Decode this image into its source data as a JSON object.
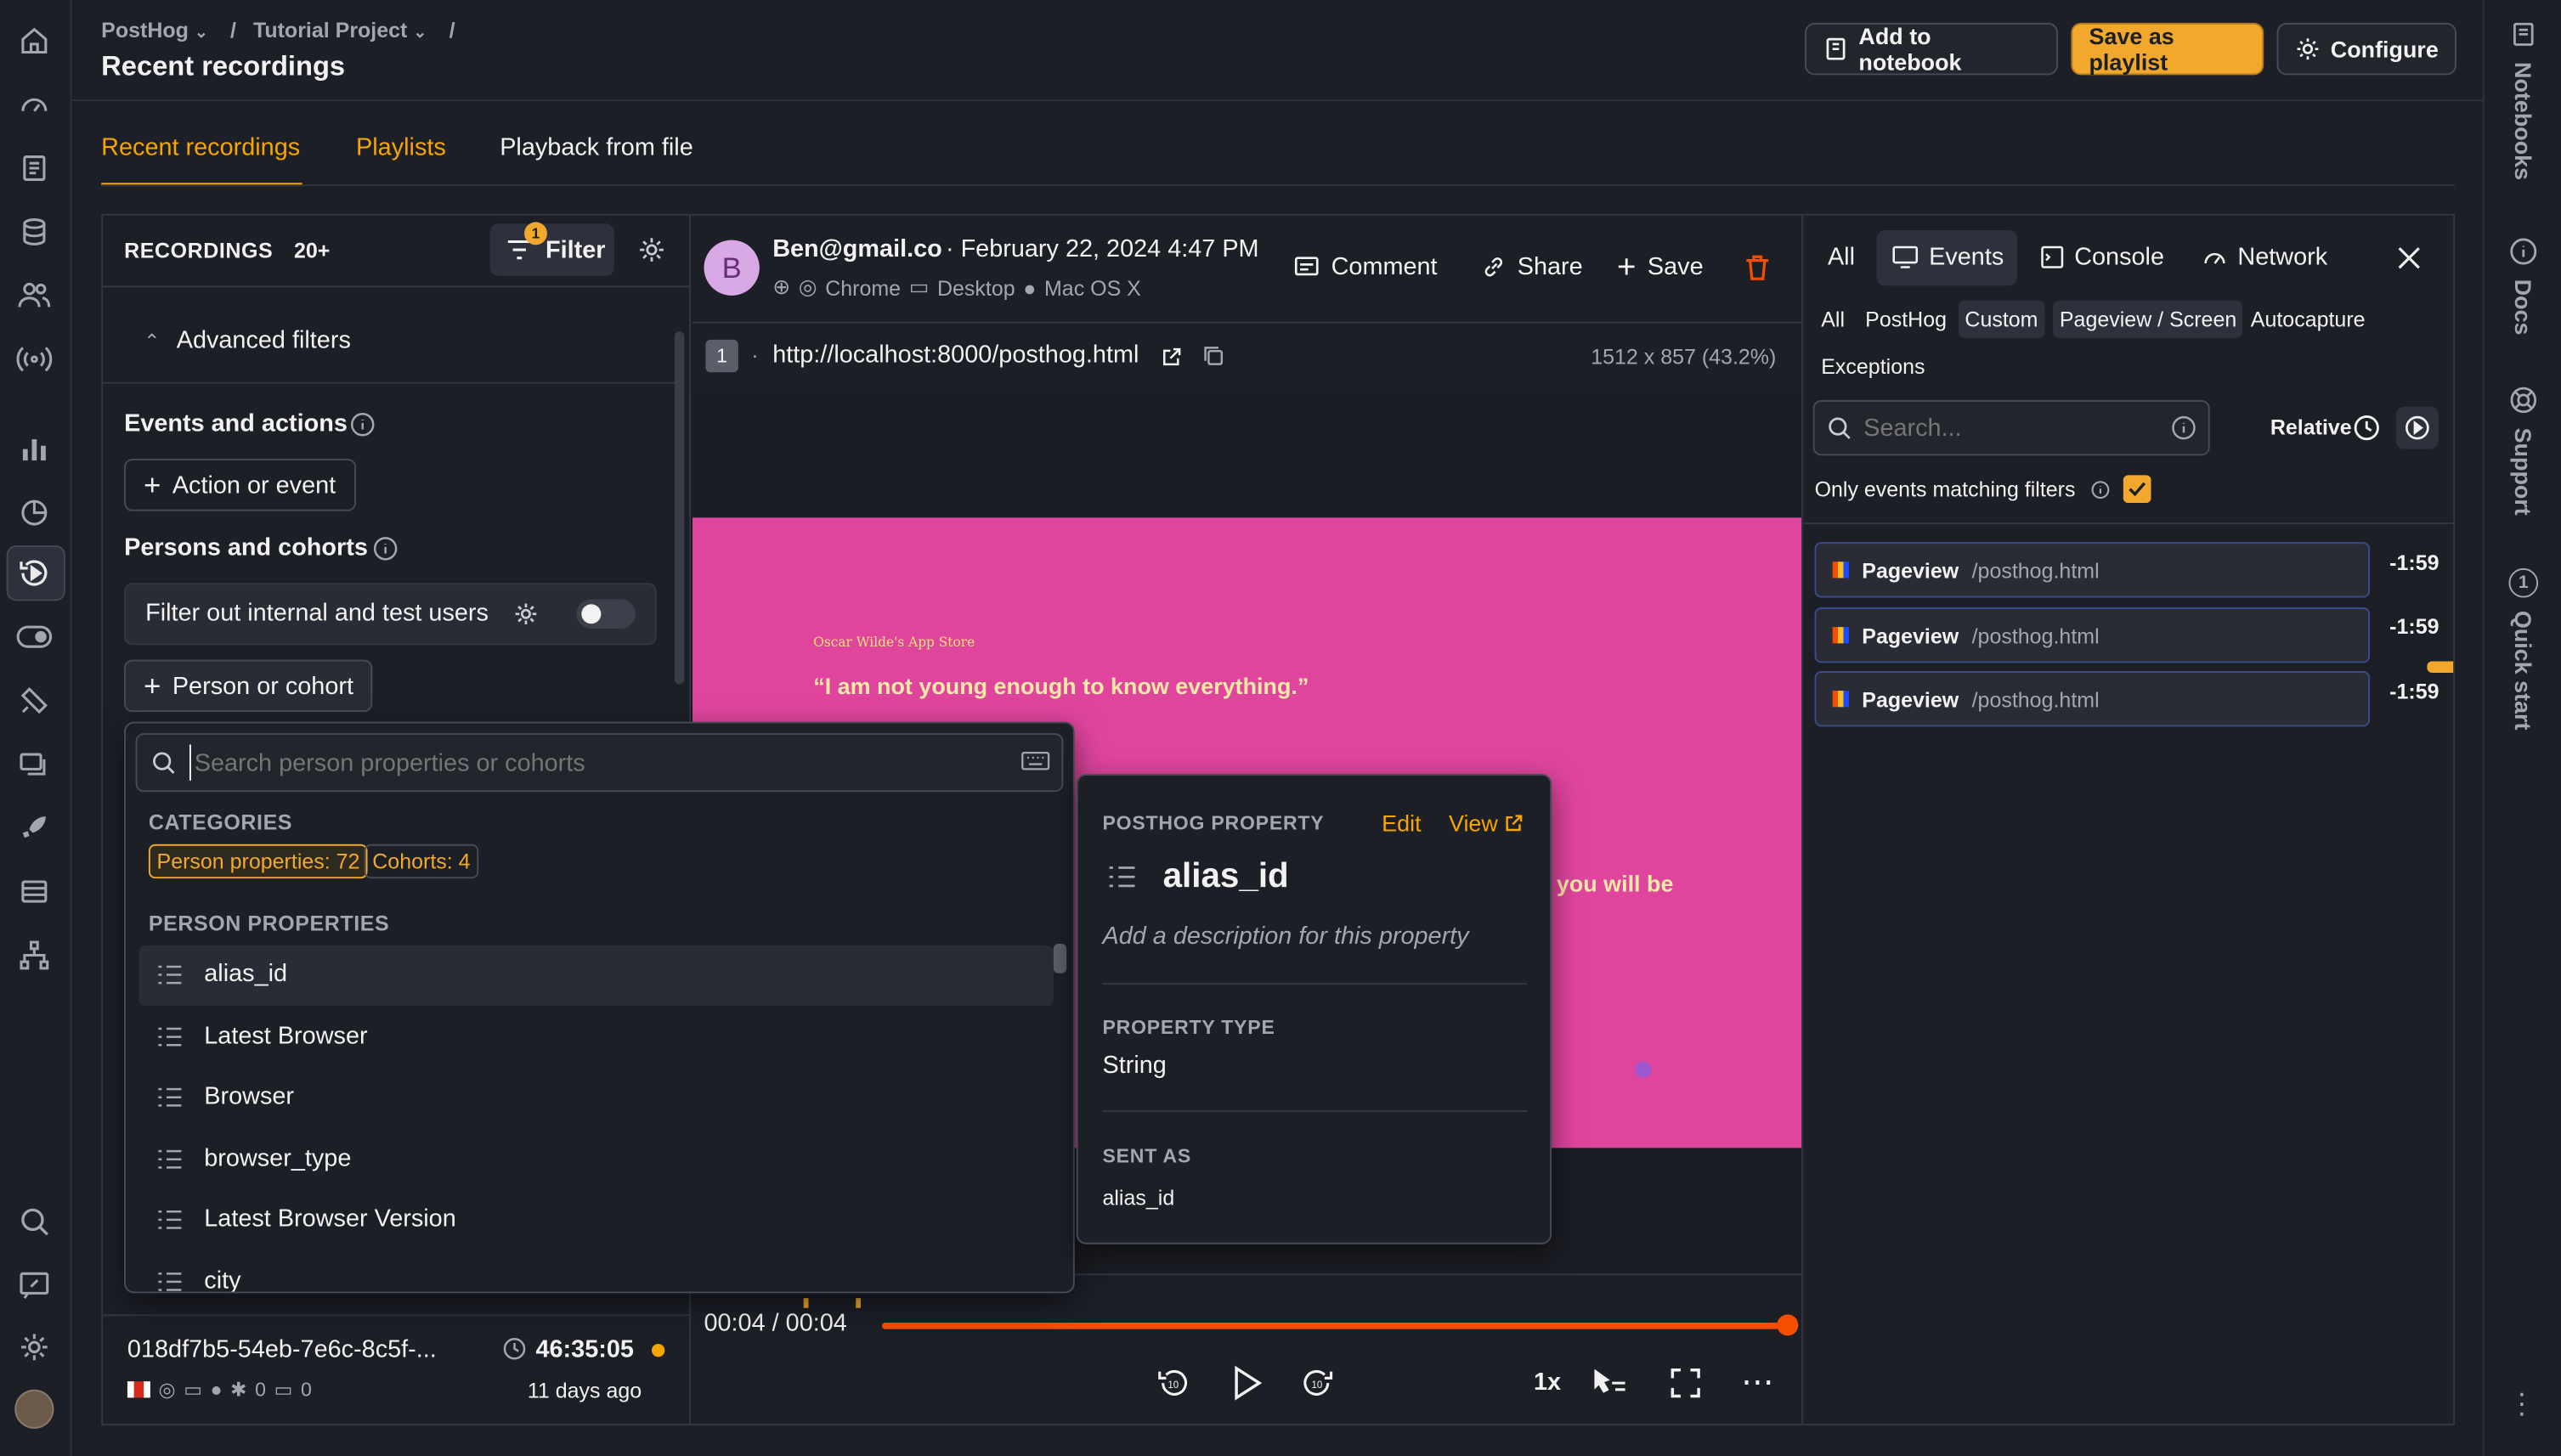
{
  "breadcrumb": {
    "org": "PostHog",
    "project": "Tutorial Project",
    "sep": "/"
  },
  "page_title": "Recent recordings",
  "header_buttons": {
    "notebook": "Add to notebook",
    "playlist": "Save as playlist",
    "configure": "Configure"
  },
  "tabs": [
    "Recent recordings",
    "Playlists",
    "Playback from file"
  ],
  "recordings": {
    "label": "RECORDINGS",
    "count": "20+",
    "filter_label": "Filter",
    "filter_badge": "1",
    "advanced": "Advanced filters",
    "events_actions": "Events and actions",
    "action_or_event": "Action or event",
    "persons_cohorts": "Persons and cohorts",
    "filter_internal": "Filter out internal and test users",
    "person_or_cohort": "Person or cohort"
  },
  "recording_item": {
    "id": "018df7b5-54eb-7e6c-8c5f-...",
    "duration": "46:35:05",
    "age": "11 days ago",
    "clicks": "0",
    "keys": "0"
  },
  "dropdown": {
    "search_placeholder": "Search person properties or cohorts",
    "categories_label": "CATEGORIES",
    "cat_person": "Person properties: 72",
    "cat_cohorts": "Cohorts: 4",
    "section_label": "PERSON PROPERTIES",
    "items": [
      "alias_id",
      "Latest Browser",
      "Browser",
      "browser_type",
      "Latest Browser Version",
      "city"
    ]
  },
  "property_popover": {
    "header": "POSTHOG PROPERTY",
    "edit": "Edit",
    "view": "View",
    "name": "alias_id",
    "description_placeholder": "Add a description for this property",
    "type_label": "PROPERTY TYPE",
    "type_value": "String",
    "sent_as_label": "SENT AS",
    "sent_as_value": "alias_id"
  },
  "player": {
    "avatar_letter": "B",
    "user": "Ben@gmail.co",
    "date": "· February 22, 2024 4:47 PM",
    "browser": "Chrome",
    "device": "Desktop",
    "os": "Mac OS X",
    "comment": "Comment",
    "share": "Share",
    "save": "Save",
    "page_number": "1",
    "url": "http://localhost:8000/posthog.html",
    "resolution": "1512 x 857 (43.2%)",
    "time": "00:04 / 00:04",
    "speed": "1x",
    "progress": 1.0
  },
  "site": {
    "store": "Oscar Wilde's App Store",
    "quote": "“I am not young enough to know everything.”",
    "fragment": "you will be"
  },
  "inspector": {
    "tabs": [
      "All",
      "Events",
      "Console",
      "Network"
    ],
    "filters": [
      "All",
      "PostHog",
      "Custom",
      "Pageview / Screen",
      "Autocapture",
      "Exceptions"
    ],
    "search_placeholder": "Search...",
    "relative": "Relative",
    "only_matching": "Only events matching filters",
    "events": [
      {
        "name": "Pageview",
        "path": "/posthog.html",
        "time": "-1:59"
      },
      {
        "name": "Pageview",
        "path": "/posthog.html",
        "time": "-1:59"
      },
      {
        "name": "Pageview",
        "path": "/posthog.html",
        "time": "-1:59"
      }
    ]
  },
  "right_sidebar": [
    "Notebooks",
    "Docs",
    "Support",
    "Quick start"
  ],
  "colors": {
    "accent": "#f7a501",
    "pink": "#e0459e",
    "danger": "#f54e00",
    "orange_dot": "#f7a501"
  }
}
